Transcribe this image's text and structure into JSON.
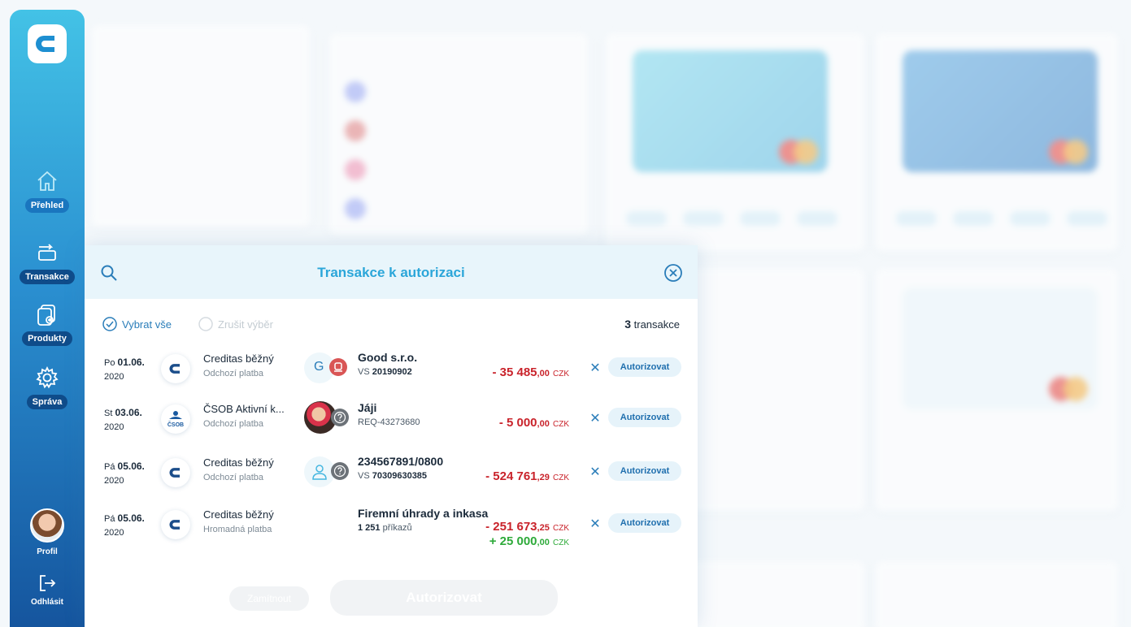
{
  "sidebar": {
    "items": [
      {
        "label": "Přehled",
        "icon": "home-icon",
        "active": true
      },
      {
        "label": "Transakce",
        "icon": "transactions-icon"
      },
      {
        "label": "Produkty",
        "icon": "products-icon"
      },
      {
        "label": "Správa",
        "icon": "gear-icon"
      }
    ],
    "profile_label": "Profil",
    "logout_label": "Odhlásit"
  },
  "modal": {
    "title": "Transakce k autorizaci",
    "select_all": "Vybrat vše",
    "unselect": "Zrušit výběr",
    "count_number": "3",
    "count_label": "transakce",
    "reject_symbol": "✕",
    "authorize_label": "Autorizovat",
    "footer_cancel": "Zamítnout",
    "footer_authorize": "Autorizovat",
    "rows": [
      {
        "day": "Po",
        "date": "01.06.",
        "year": "2020",
        "bank": "creditas",
        "account": "Creditas běžný",
        "type": "Odchozí platba",
        "party_initial": "G",
        "party_name": "Good s.r.o.",
        "sub_prefix": "VS",
        "sub_value": "20190902",
        "amount_int": "- 35 485",
        "amount_dec": ",00",
        "currency": "CZK"
      },
      {
        "day": "St",
        "date": "03.06.",
        "year": "2020",
        "bank": "csob",
        "bank_short": "ČSOB",
        "account": "ČSOB Aktivní k...",
        "type": "Odchozí platba",
        "party_name": "Jáji",
        "sub_prefix": "",
        "sub_value": "REQ-43273680",
        "amount_int": "- 5 000",
        "amount_dec": ",00",
        "currency": "CZK"
      },
      {
        "day": "Pá",
        "date": "05.06.",
        "year": "2020",
        "bank": "creditas",
        "account": "Creditas běžný",
        "type": "Odchozí platba",
        "party_name": "234567891/0800",
        "sub_prefix": "VS",
        "sub_value": "70309630385",
        "amount_int": "- 524 761",
        "amount_dec": ",29",
        "currency": "CZK"
      },
      {
        "day": "Pá",
        "date": "05.06.",
        "year": "2020",
        "bank": "creditas",
        "account": "Creditas běžný",
        "type": "Hromadná platba",
        "party_name": "Firemní úhrady a inkasa",
        "sub_count": "1 251",
        "sub_label": "příkazů",
        "amount_int": "- 251 673",
        "amount_dec": ",25",
        "currency": "CZK",
        "amount2_int": "+ 25 000",
        "amount2_dec": ",00",
        "currency2": "CZK"
      }
    ]
  },
  "colors": {
    "accent": "#2ba6d9",
    "negative": "#c9232b",
    "positive": "#2eaa3a",
    "sidebar_top": "#43c2e6",
    "sidebar_bottom": "#15559e"
  }
}
